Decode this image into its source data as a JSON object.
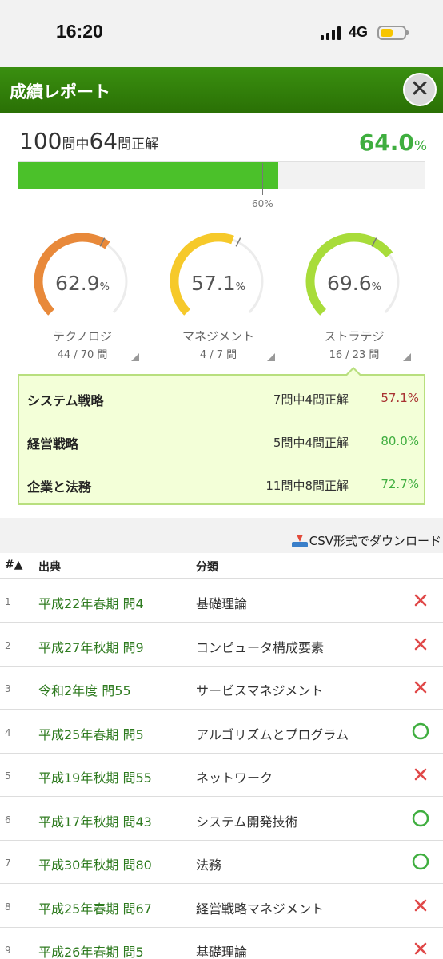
{
  "status": {
    "time": "16:20",
    "network": "4G"
  },
  "header": {
    "title": "成績レポート",
    "close_glyph": "✕"
  },
  "summary": {
    "total": "100",
    "total_suffix": "問中",
    "correct": "64",
    "correct_suffix": "問正解",
    "percent": "64.0",
    "percent_unit": "%",
    "progress_fraction": 0.64,
    "pass_mark_fraction": 0.6,
    "pass_mark_label": "60%"
  },
  "gauges": [
    {
      "value": "62.9",
      "fraction": 0.629,
      "unit": "%",
      "label": "テクノロジ",
      "count": "44 / 70 問",
      "color": "#e8893a"
    },
    {
      "value": "57.1",
      "fraction": 0.571,
      "unit": "%",
      "label": "マネジメント",
      "count": "4 / 7 問",
      "color": "#f6c92a"
    },
    {
      "value": "69.6",
      "fraction": 0.696,
      "unit": "%",
      "label": "ストラテジ",
      "count": "16 / 23 問",
      "color": "#a8dc3a"
    }
  ],
  "detail": [
    {
      "name": "システム戦略",
      "count": "7問中4問正解",
      "pct": "57.1%",
      "color": "#a83232"
    },
    {
      "name": "経営戦略",
      "count": "5問中4問正解",
      "pct": "80.0%",
      "color": "#3fae3f"
    },
    {
      "name": "企業と法務",
      "count": "11問中8問正解",
      "pct": "72.7%",
      "color": "#3fae3f"
    }
  ],
  "csv_label": "CSV形式でダウンロード",
  "table": {
    "headers": {
      "num": "#▲",
      "source": "出典",
      "category": "分類"
    },
    "rows": [
      {
        "num": "1",
        "source": "平成22年春期 問4",
        "category": "基礎理論",
        "result": "wrong"
      },
      {
        "num": "2",
        "source": "平成27年秋期 問9",
        "category": "コンピュータ構成要素",
        "result": "wrong"
      },
      {
        "num": "3",
        "source": "令和2年度 問55",
        "category": "サービスマネジメント",
        "result": "wrong"
      },
      {
        "num": "4",
        "source": "平成25年春期 問5",
        "category": "アルゴリズムとプログラム",
        "result": "correct"
      },
      {
        "num": "5",
        "source": "平成19年秋期 問55",
        "category": "ネットワーク",
        "result": "wrong"
      },
      {
        "num": "6",
        "source": "平成17年秋期 問43",
        "category": "システム開発技術",
        "result": "correct"
      },
      {
        "num": "7",
        "source": "平成30年秋期 問80",
        "category": "法務",
        "result": "correct"
      },
      {
        "num": "8",
        "source": "平成25年春期 問67",
        "category": "経営戦略マネジメント",
        "result": "wrong"
      },
      {
        "num": "9",
        "source": "平成26年春期 問5",
        "category": "基礎理論",
        "result": "wrong"
      }
    ]
  },
  "colors": {
    "correct_icon": "#3fae3f",
    "wrong_icon": "#e04848",
    "brand": "#2f7d0a"
  }
}
